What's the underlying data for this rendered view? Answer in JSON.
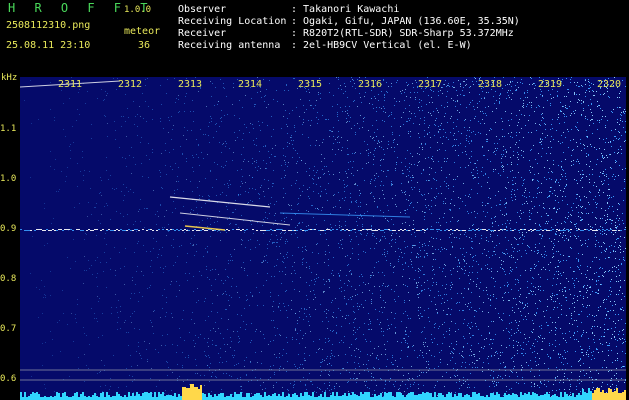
{
  "header": {
    "app_title": "H R O F F T",
    "app_version": "1.0.0",
    "filename": "2508112310.png",
    "timestamp": "25.08.11 23:10",
    "meteor_label": "meteor",
    "meteor_count": "36"
  },
  "info": [
    {
      "key": "Observer",
      "value": ": Takanori Kawachi"
    },
    {
      "key": "Receiving Location",
      "value": ": Ogaki, Gifu, JAPAN (136.60E, 35.35N)"
    },
    {
      "key": "Receiver",
      "value": ": R820T2(RTL-SDR) SDR-Sharp 53.372MHz"
    },
    {
      "key": "Receiving antenna",
      "value": ": 2el-HB9CV Vertical (el. E-W)"
    }
  ],
  "spectrogram": {
    "y_unit": "kHz",
    "y_ticks": [
      "1.1",
      "1.0",
      "0.9",
      "0.8",
      "0.7",
      "0.6"
    ],
    "x_ticks": [
      "2311",
      "2312",
      "2313",
      "2314",
      "2315",
      "2316",
      "2317",
      "2318",
      "2319",
      "2320"
    ],
    "colors": {
      "background": "#050a6a",
      "noise": "#3a9cff",
      "signal": "#ffffff",
      "hot": "#ffd84a",
      "axis": "#e8e85a"
    }
  }
}
